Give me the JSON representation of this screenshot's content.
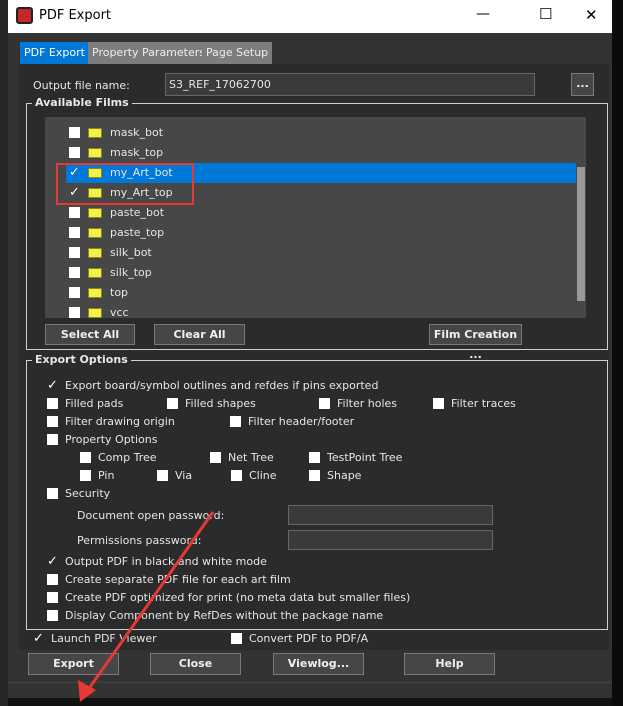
{
  "window": {
    "title": "PDF Export",
    "min": "—",
    "max": "☐",
    "close": "✕"
  },
  "tabs": [
    {
      "label": "PDF Export"
    },
    {
      "label": "Property Parameters"
    },
    {
      "label": "Page Setup"
    }
  ],
  "output": {
    "label": "Output file name:",
    "value": "S3_REF_17062700",
    "browse": "..."
  },
  "films": {
    "title": "Available Films",
    "items": [
      {
        "name": "mask_bot",
        "checked": false
      },
      {
        "name": "mask_top",
        "checked": false
      },
      {
        "name": "my_Art_bot",
        "checked": true,
        "selected": true
      },
      {
        "name": "my_Art_top",
        "checked": true
      },
      {
        "name": "paste_bot",
        "checked": false
      },
      {
        "name": "paste_top",
        "checked": false
      },
      {
        "name": "silk_bot",
        "checked": false
      },
      {
        "name": "silk_top",
        "checked": false
      },
      {
        "name": "top",
        "checked": false
      },
      {
        "name": "vcc",
        "checked": false
      }
    ],
    "select_all": "Select All",
    "clear_all": "Clear All",
    "film_creation": "Film Creation ..."
  },
  "export_options": {
    "title": "Export Options",
    "export_outlines": "Export board/symbol outlines and refdes if pins exported",
    "filled_pads": "Filled pads",
    "filled_shapes": "Filled shapes",
    "filter_holes": "Filter holes",
    "filter_traces": "Filter traces",
    "filter_origin": "Filter drawing origin",
    "filter_header": "Filter header/footer",
    "property_options": "Property Options",
    "comp_tree": "Comp Tree",
    "net_tree": "Net Tree",
    "testpoint_tree": "TestPoint Tree",
    "pin": "Pin",
    "via": "Via",
    "cline": "Cline",
    "shape": "Shape",
    "security": "Security",
    "open_password": "Document open password:",
    "permissions_password": "Permissions password:",
    "black_white": "Output PDF in black and white mode",
    "separate_file": "Create separate PDF file for each art film",
    "optimized": "Create PDF optimized for print (no meta data but smaller files)",
    "display_component": "Display Component by RefDes without the package name"
  },
  "launch_viewer": "Launch PDF Viewer",
  "convert_pdfa": "Convert PDF to PDF/A",
  "buttons": {
    "export": "Export",
    "close": "Close",
    "viewlog": "Viewlog...",
    "help": "Help"
  },
  "colors": {
    "accent": "#0078d7",
    "highlight": "#e53935"
  }
}
